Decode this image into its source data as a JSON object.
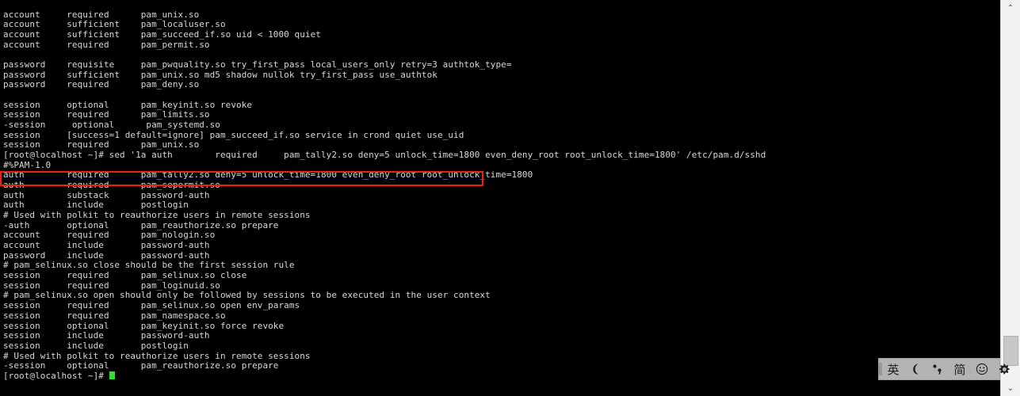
{
  "window": {
    "type": "terminal-console",
    "background_color": "#000000",
    "foreground_color": "#d8d8d8",
    "cursor_color": "#2ee02e",
    "annotation_color": "#f01e14"
  },
  "terminal": {
    "lines": [
      "",
      "account     required      pam_unix.so",
      "account     sufficient    pam_localuser.so",
      "account     sufficient    pam_succeed_if.so uid < 1000 quiet",
      "account     required      pam_permit.so",
      "",
      "password    requisite     pam_pwquality.so try_first_pass local_users_only retry=3 authtok_type=",
      "password    sufficient    pam_unix.so md5 shadow nullok try_first_pass use_authtok",
      "password    required      pam_deny.so",
      "",
      "session     optional      pam_keyinit.so revoke",
      "session     required      pam_limits.so",
      "-session     optional      pam_systemd.so",
      "session     [success=1 default=ignore] pam_succeed_if.so service in crond quiet use_uid",
      "session     required      pam_unix.so",
      "[root@localhost ~]# sed '1a auth        required     pam_tally2.so deny=5 unlock_time=1800 even_deny_root root_unlock_time=1800' /etc/pam.d/sshd",
      "#%PAM-1.0",
      "auth        required      pam_tally2.so deny=5 unlock_time=1800 even_deny_root root_unlock_time=1800",
      "auth        required      pam_sepermit.so",
      "auth        substack      password-auth",
      "auth        include       postlogin",
      "# Used with polkit to reauthorize users in remote sessions",
      "-auth       optional      pam_reauthorize.so prepare",
      "account     required      pam_nologin.so",
      "account     include       password-auth",
      "password    include       password-auth",
      "# pam_selinux.so close should be the first session rule",
      "session     required      pam_selinux.so close",
      "session     required      pam_loginuid.so",
      "# pam_selinux.so open should only be followed by sessions to be executed in the user context",
      "session     required      pam_selinux.so open env_params",
      "session     required      pam_namespace.so",
      "session     optional      pam_keyinit.so force revoke",
      "session     include       password-auth",
      "session     include       postlogin",
      "# Used with polkit to reauthorize users in remote sessions",
      "-session    optional      pam_reauthorize.so prepare"
    ],
    "prompt": "[root@localhost ~]# ",
    "highlighted_line_index": 17,
    "command_executed": "sed '1a auth        required     pam_tally2.so deny=5 unlock_time=1800 even_deny_root root_unlock_time=1800' /etc/pam.d/sshd",
    "inserted_rule": "auth        required      pam_tally2.so deny=5 unlock_time=1800 even_deny_root root_unlock_time=1800"
  },
  "scrollbar": {
    "up_arrow": "⌃",
    "down_arrow": "⌄"
  },
  "ime_toolbar": {
    "items": [
      {
        "name": "language-mode-toggle",
        "label": "英",
        "icon": "english-mode-icon"
      },
      {
        "name": "moon-mode-toggle",
        "label": "",
        "icon": "crescent-moon-icon"
      },
      {
        "name": "punctuation-mode-toggle",
        "label": "",
        "icon": "punctuation-icon"
      },
      {
        "name": "simplified-chinese-toggle",
        "label": "简",
        "icon": "simplified-chinese-icon"
      },
      {
        "name": "emoji-button",
        "label": "",
        "icon": "smiley-icon"
      },
      {
        "name": "settings-button",
        "label": "",
        "icon": "gear-icon"
      }
    ]
  }
}
